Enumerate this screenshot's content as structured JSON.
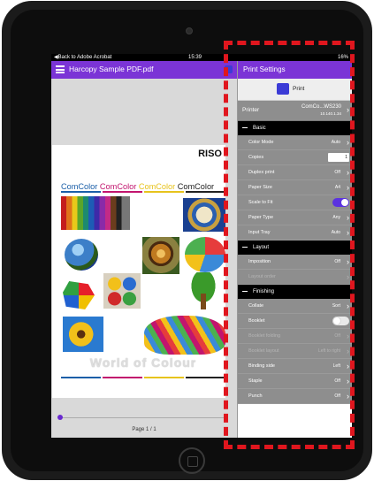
{
  "status": {
    "back": "◀Back to Adobe Acrobat",
    "time": "15:39",
    "battery": "16%"
  },
  "app": {
    "file_name": "Harcopy Sample PDF.pdf"
  },
  "pdf": {
    "brand": "RISO",
    "comcolor_words": [
      "ComColor",
      "ComColor",
      "ComColor",
      "ComColor"
    ],
    "wave_text": "World of Colour"
  },
  "pager": {
    "label": "Page 1 / 1"
  },
  "panel": {
    "title": "Print Settings",
    "print_label": "Print",
    "printer_label": "Printer",
    "printer_name": "ComCo...WS230",
    "printer_ip": "10.140.1.34",
    "sections": [
      {
        "label": "Basic"
      },
      {
        "label": "Layout"
      },
      {
        "label": "Finishing"
      }
    ],
    "basic": [
      {
        "label": "Color Mode",
        "value": "Auto"
      },
      {
        "label": "Copies",
        "value": "1"
      },
      {
        "label": "Duplex print",
        "value": "Off"
      },
      {
        "label": "Paper Size",
        "value": "A4"
      },
      {
        "label": "Scale to Fit",
        "value": ""
      },
      {
        "label": "Paper Type",
        "value": "Any"
      },
      {
        "label": "Input Tray",
        "value": "Auto"
      }
    ],
    "layout": [
      {
        "label": "Imposition",
        "value": "Off"
      },
      {
        "label": "Layout order",
        "value": ""
      }
    ],
    "finishing": [
      {
        "label": "Collate",
        "value": "Sort"
      },
      {
        "label": "Booklet",
        "value": ""
      },
      {
        "label": "Booklet folding",
        "value": "Off"
      },
      {
        "label": "Booklet layout",
        "value": "Left to right"
      },
      {
        "label": "Binding side",
        "value": "Left"
      },
      {
        "label": "Staple",
        "value": "Off"
      },
      {
        "label": "Punch",
        "value": "Off"
      }
    ],
    "scale_to_fit_on": true,
    "booklet_on": false
  },
  "colors": {
    "accent": "#7b34d6",
    "highlight": "#e0161e",
    "toggle_on": "#5b33e0"
  }
}
